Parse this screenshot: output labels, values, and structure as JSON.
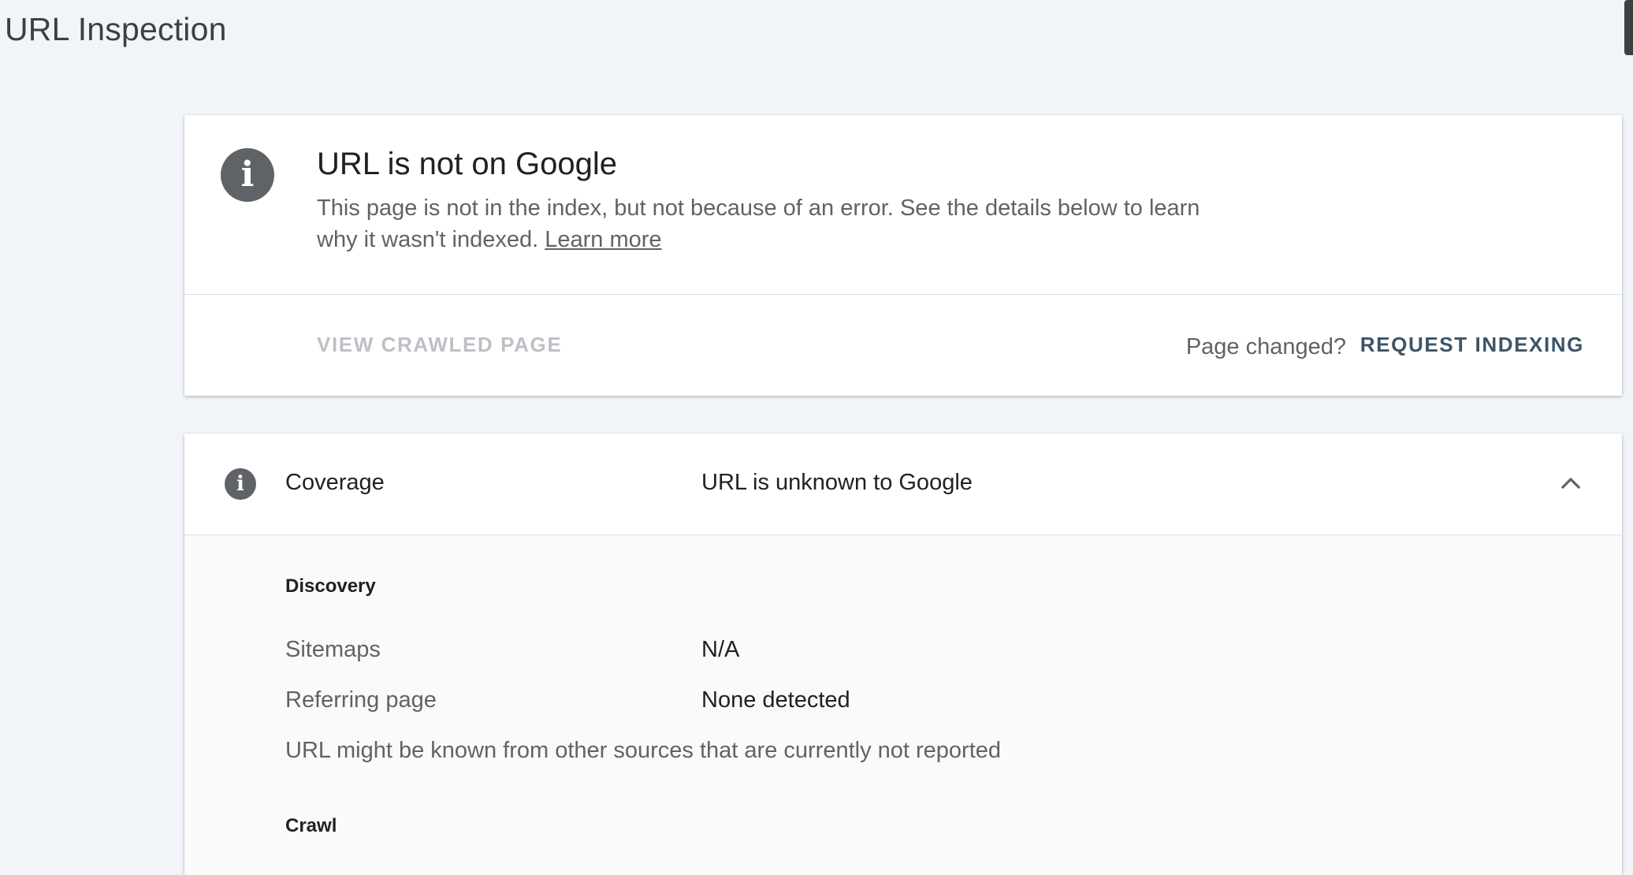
{
  "page": {
    "title": "URL Inspection"
  },
  "status": {
    "icon": "info-icon",
    "title": "URL is not on Google",
    "description": "This page is not in the index, but not because of an error. See the details below to learn why it wasn't indexed.",
    "learn_more": "Learn more",
    "view_crawled_label": "VIEW CRAWLED PAGE",
    "page_changed_label": "Page changed?",
    "request_indexing_label": "REQUEST INDEXING"
  },
  "coverage": {
    "icon": "info-icon",
    "label": "Coverage",
    "value": "URL is unknown to Google",
    "expanded": true,
    "discovery": {
      "heading": "Discovery",
      "rows": [
        {
          "label": "Sitemaps",
          "value": "N/A"
        },
        {
          "label": "Referring page",
          "value": "None detected"
        }
      ],
      "note": "URL might be known from other sources that are currently not reported"
    },
    "crawl": {
      "heading": "Crawl"
    }
  },
  "colors": {
    "background": "#f1f4f9",
    "icon_gray": "#5f6368",
    "action_blue": "#3c5468",
    "disabled": "#bdc1c6"
  }
}
